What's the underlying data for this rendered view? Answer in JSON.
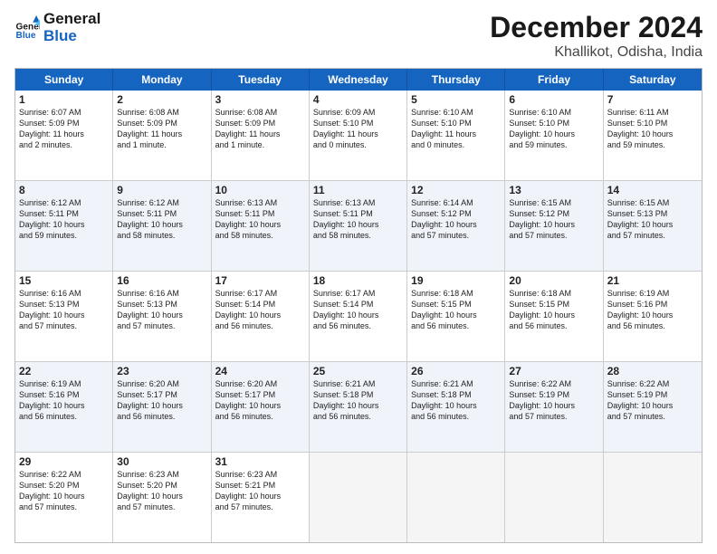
{
  "header": {
    "logo_line1": "General",
    "logo_line2": "Blue",
    "title": "December 2024",
    "subtitle": "Khallikot, Odisha, India"
  },
  "days": [
    "Sunday",
    "Monday",
    "Tuesday",
    "Wednesday",
    "Thursday",
    "Friday",
    "Saturday"
  ],
  "rows": [
    [
      {
        "day": "1",
        "info": "Sunrise: 6:07 AM\nSunset: 5:09 PM\nDaylight: 11 hours\nand 2 minutes."
      },
      {
        "day": "2",
        "info": "Sunrise: 6:08 AM\nSunset: 5:09 PM\nDaylight: 11 hours\nand 1 minute."
      },
      {
        "day": "3",
        "info": "Sunrise: 6:08 AM\nSunset: 5:09 PM\nDaylight: 11 hours\nand 1 minute."
      },
      {
        "day": "4",
        "info": "Sunrise: 6:09 AM\nSunset: 5:10 PM\nDaylight: 11 hours\nand 0 minutes."
      },
      {
        "day": "5",
        "info": "Sunrise: 6:10 AM\nSunset: 5:10 PM\nDaylight: 11 hours\nand 0 minutes."
      },
      {
        "day": "6",
        "info": "Sunrise: 6:10 AM\nSunset: 5:10 PM\nDaylight: 10 hours\nand 59 minutes."
      },
      {
        "day": "7",
        "info": "Sunrise: 6:11 AM\nSunset: 5:10 PM\nDaylight: 10 hours\nand 59 minutes."
      }
    ],
    [
      {
        "day": "8",
        "info": "Sunrise: 6:12 AM\nSunset: 5:11 PM\nDaylight: 10 hours\nand 59 minutes."
      },
      {
        "day": "9",
        "info": "Sunrise: 6:12 AM\nSunset: 5:11 PM\nDaylight: 10 hours\nand 58 minutes."
      },
      {
        "day": "10",
        "info": "Sunrise: 6:13 AM\nSunset: 5:11 PM\nDaylight: 10 hours\nand 58 minutes."
      },
      {
        "day": "11",
        "info": "Sunrise: 6:13 AM\nSunset: 5:11 PM\nDaylight: 10 hours\nand 58 minutes."
      },
      {
        "day": "12",
        "info": "Sunrise: 6:14 AM\nSunset: 5:12 PM\nDaylight: 10 hours\nand 57 minutes."
      },
      {
        "day": "13",
        "info": "Sunrise: 6:15 AM\nSunset: 5:12 PM\nDaylight: 10 hours\nand 57 minutes."
      },
      {
        "day": "14",
        "info": "Sunrise: 6:15 AM\nSunset: 5:13 PM\nDaylight: 10 hours\nand 57 minutes."
      }
    ],
    [
      {
        "day": "15",
        "info": "Sunrise: 6:16 AM\nSunset: 5:13 PM\nDaylight: 10 hours\nand 57 minutes."
      },
      {
        "day": "16",
        "info": "Sunrise: 6:16 AM\nSunset: 5:13 PM\nDaylight: 10 hours\nand 57 minutes."
      },
      {
        "day": "17",
        "info": "Sunrise: 6:17 AM\nSunset: 5:14 PM\nDaylight: 10 hours\nand 56 minutes."
      },
      {
        "day": "18",
        "info": "Sunrise: 6:17 AM\nSunset: 5:14 PM\nDaylight: 10 hours\nand 56 minutes."
      },
      {
        "day": "19",
        "info": "Sunrise: 6:18 AM\nSunset: 5:15 PM\nDaylight: 10 hours\nand 56 minutes."
      },
      {
        "day": "20",
        "info": "Sunrise: 6:18 AM\nSunset: 5:15 PM\nDaylight: 10 hours\nand 56 minutes."
      },
      {
        "day": "21",
        "info": "Sunrise: 6:19 AM\nSunset: 5:16 PM\nDaylight: 10 hours\nand 56 minutes."
      }
    ],
    [
      {
        "day": "22",
        "info": "Sunrise: 6:19 AM\nSunset: 5:16 PM\nDaylight: 10 hours\nand 56 minutes."
      },
      {
        "day": "23",
        "info": "Sunrise: 6:20 AM\nSunset: 5:17 PM\nDaylight: 10 hours\nand 56 minutes."
      },
      {
        "day": "24",
        "info": "Sunrise: 6:20 AM\nSunset: 5:17 PM\nDaylight: 10 hours\nand 56 minutes."
      },
      {
        "day": "25",
        "info": "Sunrise: 6:21 AM\nSunset: 5:18 PM\nDaylight: 10 hours\nand 56 minutes."
      },
      {
        "day": "26",
        "info": "Sunrise: 6:21 AM\nSunset: 5:18 PM\nDaylight: 10 hours\nand 56 minutes."
      },
      {
        "day": "27",
        "info": "Sunrise: 6:22 AM\nSunset: 5:19 PM\nDaylight: 10 hours\nand 57 minutes."
      },
      {
        "day": "28",
        "info": "Sunrise: 6:22 AM\nSunset: 5:19 PM\nDaylight: 10 hours\nand 57 minutes."
      }
    ],
    [
      {
        "day": "29",
        "info": "Sunrise: 6:22 AM\nSunset: 5:20 PM\nDaylight: 10 hours\nand 57 minutes."
      },
      {
        "day": "30",
        "info": "Sunrise: 6:23 AM\nSunset: 5:20 PM\nDaylight: 10 hours\nand 57 minutes."
      },
      {
        "day": "31",
        "info": "Sunrise: 6:23 AM\nSunset: 5:21 PM\nDaylight: 10 hours\nand 57 minutes."
      },
      {
        "day": "",
        "info": ""
      },
      {
        "day": "",
        "info": ""
      },
      {
        "day": "",
        "info": ""
      },
      {
        "day": "",
        "info": ""
      }
    ]
  ]
}
